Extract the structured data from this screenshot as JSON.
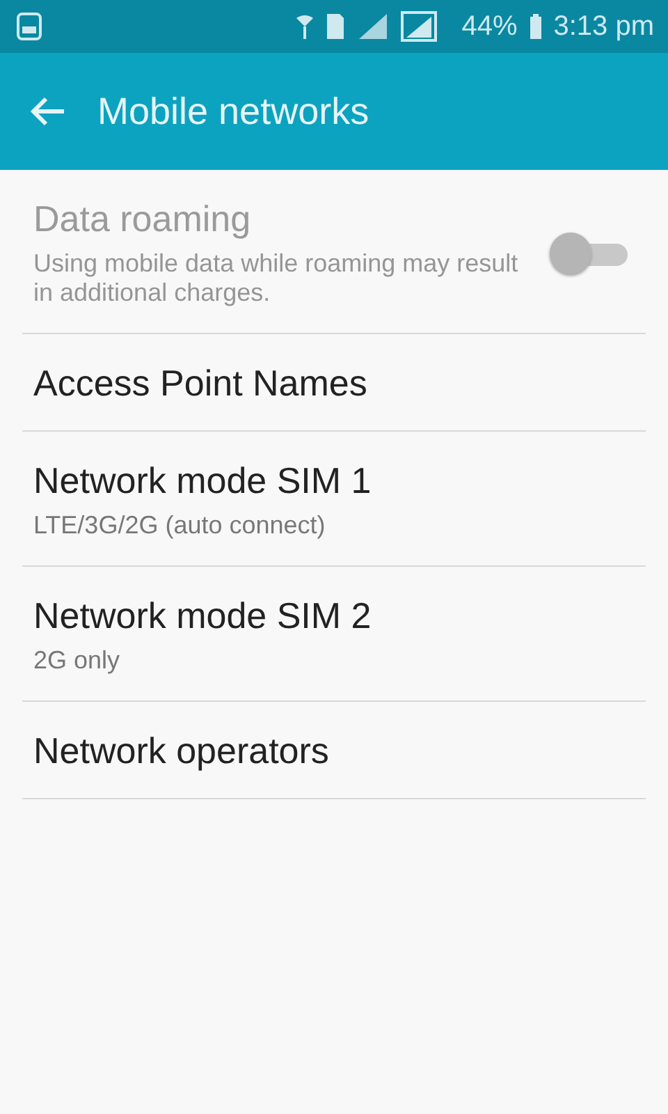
{
  "status_bar": {
    "battery": "44%",
    "time": "3:13 pm"
  },
  "app_bar": {
    "title": "Mobile networks"
  },
  "settings": [
    {
      "kind": "switch",
      "title": "Data roaming",
      "summary": "Using mobile data while roaming may result in additional charges.",
      "disabled": true,
      "on": false
    },
    {
      "kind": "plain",
      "title": "Access Point Names",
      "disabled": false
    },
    {
      "kind": "plain",
      "title": "Network mode SIM 1",
      "summary": "LTE/3G/2G (auto connect)",
      "disabled": false
    },
    {
      "kind": "plain",
      "title": "Network mode SIM 2",
      "summary": "2G only",
      "disabled": false
    },
    {
      "kind": "plain",
      "title": "Network operators",
      "disabled": false
    }
  ]
}
